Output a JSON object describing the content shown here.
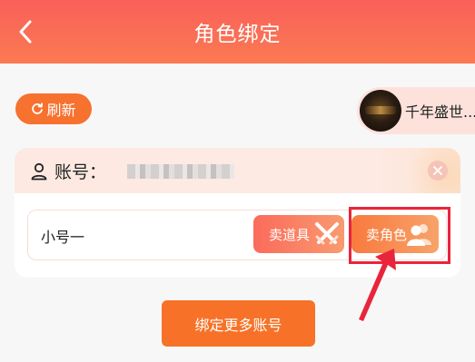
{
  "header": {
    "title": "角色绑定",
    "back_icon": "chevron-left-icon"
  },
  "toolbar": {
    "refresh_label": "刷新",
    "refresh_icon": "refresh-icon"
  },
  "game": {
    "name": "千年盛世...",
    "logo_icon": "game-logo"
  },
  "account": {
    "label": "账号：",
    "close_icon": "close-icon",
    "user_icon": "user-icon"
  },
  "role": {
    "name": "小号一",
    "sell_item_label": "卖道具",
    "sell_item_icon": "crossed-swords-icon",
    "sell_role_label": "卖角色",
    "sell_role_icon": "users-icon"
  },
  "footer": {
    "bind_more_label": "绑定更多账号"
  },
  "colors": {
    "header_start": "#f9605a",
    "header_end": "#fb7a52",
    "accent_orange": "#f7712f",
    "highlight_red": "#e9253b"
  }
}
